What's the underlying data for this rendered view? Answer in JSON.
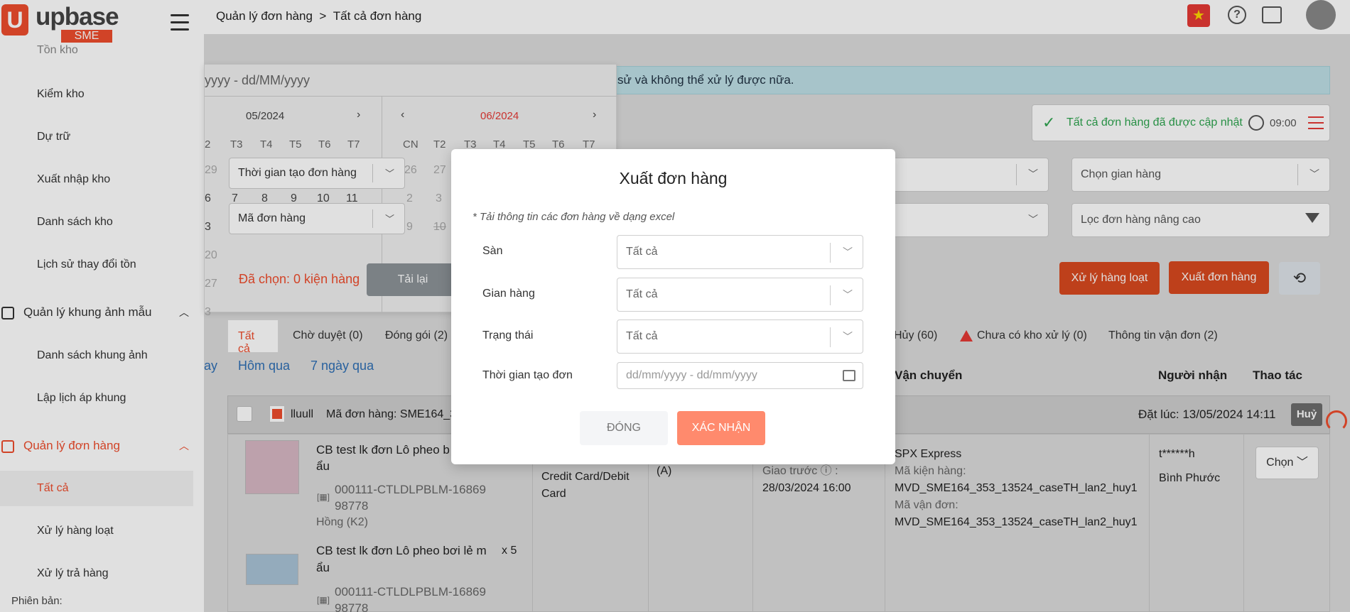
{
  "app": {
    "logo_text": "upbase",
    "logo_badge": "SME"
  },
  "sidebar": {
    "items_top": [
      {
        "label": "Tồn kho"
      },
      {
        "label": "Kiểm kho"
      },
      {
        "label": "Dự trữ"
      },
      {
        "label": "Xuất nhập kho"
      },
      {
        "label": "Danh sách kho"
      },
      {
        "label": "Lịch sử thay đổi tồn"
      }
    ],
    "group_frames": {
      "label": "Quản lý khung ảnh mẫu"
    },
    "items_frames": [
      {
        "label": "Danh sách khung ảnh"
      },
      {
        "label": "Lập lịch áp khung"
      }
    ],
    "group_orders": {
      "label": "Quản lý đơn hàng"
    },
    "items_orders": [
      {
        "label": "Tất cả"
      },
      {
        "label": "Xử lý hàng loạt"
      },
      {
        "label": "Xử lý trả hàng"
      }
    ],
    "version_label": "Phiên bản:"
  },
  "header": {
    "breadcrumb_parent": "Quản lý đơn hàng",
    "breadcrumb_sep": ">",
    "breadcrumb_current": "Tất cả đơn hàng"
  },
  "main": {
    "info_banner": "sử và không thể xử lý được nữa.",
    "update_status": "Tất cả đơn hàng đã được cập nhật",
    "update_time": "09:00",
    "filter_shop_placeholder": "Chọn gian hàng",
    "filter_advanced_placeholder": "Lọc đơn hàng nâng cao",
    "selected_count": "Đã chọn: 0 kiện hàng",
    "reload_button": "Tải lại",
    "bulk_button": "Xử lý hàng loạt",
    "export_button": "Xuất đơn hàng",
    "tabs": [
      {
        "label": "Tất cả"
      },
      {
        "label": "Chờ duyệt (0)"
      },
      {
        "label": "Đóng gói (2)"
      },
      {
        "label": "Hủy (60)"
      },
      {
        "label": "Chưa có kho xử lý (0)"
      },
      {
        "label": "Thông tin vận đơn (2)"
      }
    ],
    "quick_ranges": [
      "ay",
      "Hôm qua",
      "7 ngày qua"
    ],
    "columns": {
      "shipping": "Vận chuyển",
      "receiver": "Người nhận",
      "action": "Thao tác"
    },
    "order": {
      "shop_name": "lluull",
      "order_code": "Mã đơn hàng: SME164_3",
      "placed_at": "Đặt lúc: 13/05/2024 14:11",
      "status_badge": "Huỷ",
      "payment": "Credit Card/Debit Card",
      "grade": "(A)",
      "deliver_label": "Giao trước",
      "deliver_date": "28/03/2024 16:00",
      "carrier": "SPX Express",
      "package_label": "Mã kiện hàng:",
      "package_code": "MVD_SME164_353_13524_caseTH_lan2_huy1",
      "waybill_label": "Mã vận đơn:",
      "waybill_code": "MVD_SME164_353_13524_caseTH_lan2_huy1",
      "receiver_name": "t******h",
      "receiver_province": "Bình Phước",
      "choose_button": "Chọn",
      "products": [
        {
          "name_line1": "CB test lk đơn Lô pheo b",
          "name_line2": "ẩu",
          "sku_line1": "000111-CTLDLPBLM-16869",
          "sku_line2": "98778",
          "variant": "Hồng (K2)",
          "qty": ""
        },
        {
          "name_line1": "CB test lk đơn Lô pheo bơi lẻ m",
          "name_line2": "ẩu",
          "sku_line1": "000111-CTLDLPBLM-16869",
          "sku_line2": "98778",
          "variant": "",
          "qty": "x 5"
        }
      ]
    }
  },
  "datepicker": {
    "input_placeholder": "yyyy - dd/MM/yyyy",
    "left_month": "05/2024",
    "right_month": "06/2024",
    "left_weekdays": [
      "2",
      "T3",
      "T4",
      "T5",
      "T6",
      "T7"
    ],
    "right_weekdays": [
      "CN",
      "T2",
      "T3",
      "T4",
      "T5",
      "T6",
      "T7"
    ],
    "time_type_select": "Thời gian tạo đơn hàng",
    "code_select": "Mã đơn hàng",
    "left_row1": [
      "29",
      "",
      "",
      "",
      "",
      ""
    ],
    "left_row2": [
      "6",
      "7",
      "8",
      "9",
      "10",
      "11"
    ],
    "left_row3": [
      "3"
    ],
    "left_row4": [
      "20"
    ],
    "left_row5": [
      "27"
    ],
    "left_row6": [
      "3"
    ],
    "right_row1": [
      "26",
      "27"
    ],
    "right_row2": [
      "2",
      "3"
    ],
    "right_row3": [
      "9",
      "10"
    ]
  },
  "modal": {
    "title": "Xuất đơn hàng",
    "note": "* Tải thông tin các đơn hàng về dạng excel",
    "platform_label": "Sàn",
    "platform_value": "Tất cả",
    "shop_label": "Gian hàng",
    "shop_value": "Tất cả",
    "status_label": "Trạng thái",
    "status_value": "Tất cả",
    "created_label": "Thời gian tạo đơn",
    "created_placeholder": "dd/mm/yyyy - dd/mm/yyyy",
    "close_button": "ĐÓNG",
    "confirm_button": "XÁC NHẬN"
  },
  "colors": {
    "accent": "#ee4d2d",
    "success": "#2ea44f",
    "link": "#2f6fb4",
    "banner": "#bfe0e6"
  }
}
